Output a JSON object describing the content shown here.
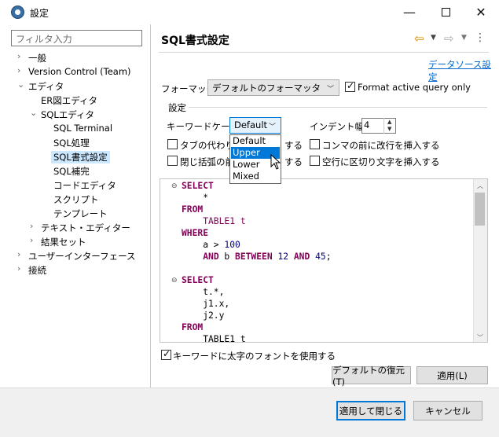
{
  "window": {
    "title": "設定",
    "controls": {
      "minimize": "—",
      "close": "✕"
    }
  },
  "sidebar": {
    "filter_placeholder": "フィルタ入力",
    "items": [
      {
        "label": "一般",
        "level": 0,
        "chevron": ">"
      },
      {
        "label": "Version Control (Team)",
        "level": 0,
        "chevron": ">"
      },
      {
        "label": "エディタ",
        "level": 0,
        "chevron": "v"
      },
      {
        "label": "ER図エディタ",
        "level": 1,
        "chevron": ""
      },
      {
        "label": "SQLエディタ",
        "level": 1,
        "chevron": "v"
      },
      {
        "label": "SQL Terminal",
        "level": 2,
        "chevron": ""
      },
      {
        "label": "SQL処理",
        "level": 2,
        "chevron": ""
      },
      {
        "label": "SQL書式設定",
        "level": 2,
        "chevron": "",
        "selected": true
      },
      {
        "label": "SQL補完",
        "level": 2,
        "chevron": ""
      },
      {
        "label": "コードエディタ",
        "level": 2,
        "chevron": ""
      },
      {
        "label": "スクリプト",
        "level": 2,
        "chevron": ""
      },
      {
        "label": "テンプレート",
        "level": 2,
        "chevron": ""
      },
      {
        "label": "テキスト・エディター",
        "level": 1,
        "chevron": ">"
      },
      {
        "label": "結果セット",
        "level": 1,
        "chevron": ">"
      },
      {
        "label": "ユーザーインターフェース",
        "level": 0,
        "chevron": ">"
      },
      {
        "label": "接続",
        "level": 0,
        "chevron": ">"
      }
    ]
  },
  "page": {
    "title": "SQL書式設定",
    "datasource_link": "データソース設定",
    "formatter_label": "フォーマッタ:",
    "formatter_value": "デフォルトのフォーマッタ",
    "format_active_query_label": "Format active query only",
    "format_active_query_checked": true,
    "settings_group_label": "設定",
    "keyword_case_label": "キーワードケース:",
    "keyword_case_value": "Default",
    "indent_width_label": "インデント幅:",
    "indent_width_value": "4",
    "opt_tabs_label": "タブの代わりに空白を使用する",
    "opt_tabs_visible_prefix": "タブの代わりに",
    "opt_tabs_visible_suffix": "する",
    "opt_newline_comma_label": "コンマの前に改行を挿入する",
    "opt_close_paren_visible_prefix": "閉じ括弧の前",
    "opt_close_paren_visible_suffix": "する",
    "opt_blank_line_label": "空行に区切り文字を挿入する",
    "bold_keywords_label": "キーワードに太字のフォントを使用する",
    "bold_keywords_checked": true,
    "restore_defaults_button": "デフォルトの復元(T)",
    "apply_button": "適用(L)"
  },
  "keyword_case_dropdown": {
    "options": [
      "Default",
      "Upper",
      "Lower",
      "Mixed"
    ],
    "highlighted": "Upper"
  },
  "editor": {
    "lines": [
      [
        {
          "t": "SELECT",
          "c": "kw"
        }
      ],
      [
        {
          "t": "    *",
          "c": ""
        }
      ],
      [
        {
          "t": "FROM",
          "c": "kw"
        }
      ],
      [
        {
          "t": "    TABLE1 t",
          "c": "tb"
        }
      ],
      [
        {
          "t": "WHERE",
          "c": "kw"
        }
      ],
      [
        {
          "t": "    a > ",
          "c": ""
        },
        {
          "t": "100",
          "c": "num"
        }
      ],
      [
        {
          "t": "    ",
          "c": ""
        },
        {
          "t": "AND",
          "c": "kw"
        },
        {
          "t": " b ",
          "c": ""
        },
        {
          "t": "BETWEEN",
          "c": "kw"
        },
        {
          "t": " ",
          "c": ""
        },
        {
          "t": "12",
          "c": "num"
        },
        {
          "t": " ",
          "c": ""
        },
        {
          "t": "AND",
          "c": "kw"
        },
        {
          "t": " ",
          "c": ""
        },
        {
          "t": "45",
          "c": "num"
        },
        {
          "t": ";",
          "c": ""
        }
      ],
      [
        {
          "t": "",
          "c": ""
        }
      ],
      [
        {
          "t": "SELECT",
          "c": "kw"
        }
      ],
      [
        {
          "t": "    t.*,",
          "c": ""
        }
      ],
      [
        {
          "t": "    j1.x,",
          "c": ""
        }
      ],
      [
        {
          "t": "    j2.y",
          "c": ""
        }
      ],
      [
        {
          "t": "FROM",
          "c": "kw"
        }
      ],
      [
        {
          "t": "    TABLE1 t",
          "c": ""
        }
      ]
    ],
    "fold_markers": [
      "⊖",
      "⊖"
    ]
  },
  "footer": {
    "apply_close_button": "適用して閉じる",
    "cancel_button": "キャンセル"
  }
}
